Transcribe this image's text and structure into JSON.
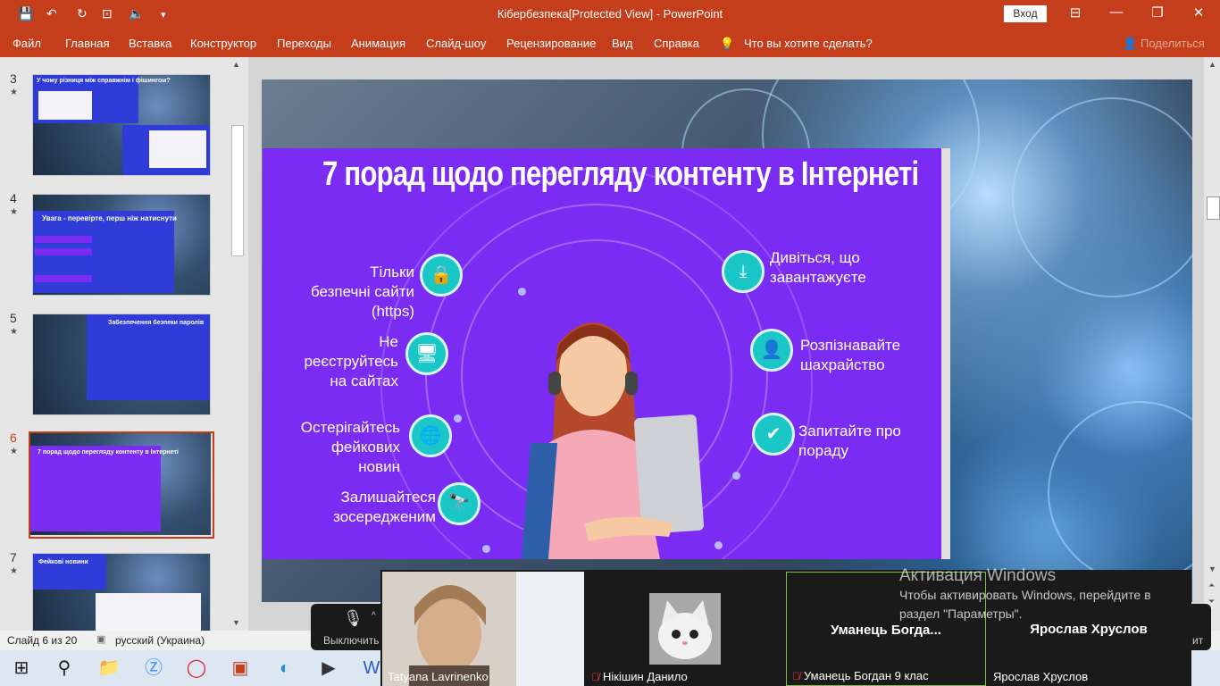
{
  "app": {
    "title": "Кібербезпека[Protected View]  -  PowerPoint",
    "sign_in": "Вход"
  },
  "menu": {
    "items": [
      "Файл",
      "Главная",
      "Вставка",
      "Конструктор",
      "Переходы",
      "Анимация",
      "Слайд-шоу",
      "Рецензирование",
      "Вид",
      "Справка"
    ],
    "tell_me": "Что вы хотите сделать?",
    "share": "Поделиться"
  },
  "thumbnails": [
    {
      "number": "3",
      "star": "★",
      "caption": "У чому різниця між справжнім і фішингом?"
    },
    {
      "number": "4",
      "star": "★",
      "caption": "Увага - перевірте, перш ніж натиснути"
    },
    {
      "number": "5",
      "star": "★",
      "caption": "Забезпечення безпеки паролів"
    },
    {
      "number": "6",
      "star": "★",
      "caption": "7 порад щодо перегляду контенту в Інтернеті"
    },
    {
      "number": "7",
      "star": "★",
      "caption": "Фейкові новини"
    }
  ],
  "slide": {
    "title": "7 порад щодо перегляду контенту в Інтернеті",
    "tips_left": [
      {
        "text": "Тільки безпечні сайти (https)",
        "icon": "lock-icon",
        "glyph": "🔒"
      },
      {
        "text": "Не реєструйтесь на сайтах",
        "icon": "monitor-icon",
        "glyph": "🖥"
      },
      {
        "text": "Остерігайтесь фейкових новин",
        "icon": "globe-icon",
        "glyph": "🌐"
      },
      {
        "text": "Залишайтеся зосередженим",
        "icon": "binoculars-icon",
        "glyph": "🔭"
      }
    ],
    "tips_right": [
      {
        "text": "Дивіться, що завантажуєте",
        "icon": "download-icon",
        "glyph": "⤓"
      },
      {
        "text": "Розпізнавайте шахрайство",
        "icon": "head-icon",
        "glyph": "👤"
      },
      {
        "text": "Запитайте про пораду",
        "icon": "shield-check-icon",
        "glyph": "✔"
      }
    ]
  },
  "status": {
    "slide_counter": "Слайд 6 из 20",
    "language": "русский (Украина)"
  },
  "zoom": {
    "unmute_label": "Выключить",
    "participants": [
      {
        "name": "Tatyana Lavrinenko",
        "muted": false
      },
      {
        "name": "Нікішин Данило",
        "muted": true
      },
      {
        "name": "Уманець Богдан 9 клас",
        "big_label": "Уманець  Богда...",
        "muted": true
      },
      {
        "name": "Ярослав Хруслов",
        "big_label": "Ярослав Хруслов",
        "muted": false
      }
    ],
    "partial_label": "ит"
  },
  "watermark": {
    "title": "Активация Windows",
    "body": "Чтобы активировать Windows, перейдите в раздел \"Параметры\"."
  }
}
